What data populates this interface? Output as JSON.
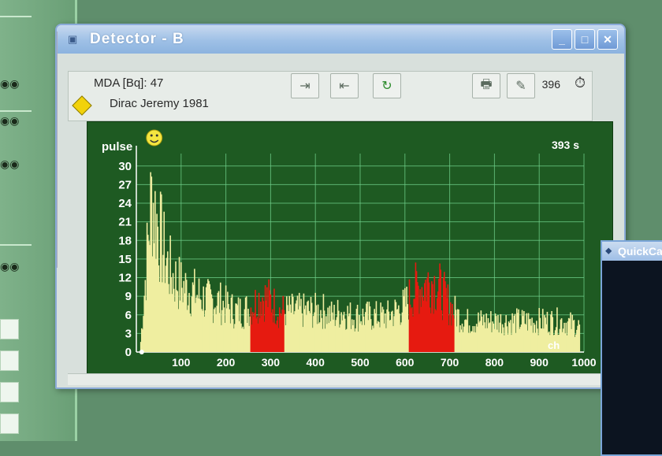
{
  "window": {
    "title": "Detector  -   B",
    "controls": {
      "minimize": "_",
      "maximize": "□",
      "close": "✕"
    }
  },
  "info": {
    "mda": "MDA [Bq]:  47",
    "person": "Dirac Jeremy  1981",
    "counter": "396"
  },
  "toolbar": {
    "buttons": [
      {
        "name": "forward-icon",
        "glyph": "⇥"
      },
      {
        "name": "back-icon",
        "glyph": "⇤"
      },
      {
        "name": "refresh-icon",
        "glyph": "↻"
      },
      {
        "name": "printer-icon",
        "glyph": "🖶"
      },
      {
        "name": "tools-icon",
        "glyph": "✎"
      }
    ]
  },
  "chart_data": {
    "type": "area",
    "ylabel": "pulse",
    "xunit": "ch",
    "time_label": "393 s",
    "xlim": [
      0,
      1000
    ],
    "ylim": [
      0,
      32
    ],
    "xticks": [
      100,
      200,
      300,
      400,
      500,
      600,
      700,
      800,
      900,
      1000
    ],
    "yticks": [
      0,
      3,
      6,
      9,
      12,
      15,
      18,
      21,
      24,
      27,
      30
    ],
    "grid": true,
    "colors": {
      "background": "#1e5a22",
      "grid": "#6fd08a",
      "series": "#efeea0",
      "region": "#e61a10"
    },
    "regions": [
      [
        255,
        330
      ],
      [
        610,
        710
      ]
    ],
    "envelope": [
      [
        10,
        2
      ],
      [
        15,
        8
      ],
      [
        20,
        14
      ],
      [
        25,
        20
      ],
      [
        30,
        26
      ],
      [
        35,
        31
      ],
      [
        40,
        28
      ],
      [
        50,
        24
      ],
      [
        60,
        20
      ],
      [
        70,
        17
      ],
      [
        80,
        15
      ],
      [
        90,
        14
      ],
      [
        100,
        13
      ],
      [
        120,
        12
      ],
      [
        140,
        11
      ],
      [
        160,
        10
      ],
      [
        180,
        10
      ],
      [
        200,
        9
      ],
      [
        220,
        8
      ],
      [
        240,
        8
      ],
      [
        260,
        9
      ],
      [
        280,
        11
      ],
      [
        300,
        10
      ],
      [
        320,
        8
      ],
      [
        340,
        8
      ],
      [
        360,
        8
      ],
      [
        380,
        8
      ],
      [
        400,
        8
      ],
      [
        420,
        8
      ],
      [
        440,
        7
      ],
      [
        460,
        8
      ],
      [
        480,
        7
      ],
      [
        500,
        7
      ],
      [
        520,
        7
      ],
      [
        540,
        7
      ],
      [
        560,
        7
      ],
      [
        580,
        8
      ],
      [
        600,
        9
      ],
      [
        620,
        12
      ],
      [
        640,
        13
      ],
      [
        660,
        14
      ],
      [
        680,
        12
      ],
      [
        700,
        9
      ],
      [
        720,
        7
      ],
      [
        740,
        6
      ],
      [
        760,
        6
      ],
      [
        800,
        6
      ],
      [
        850,
        6
      ],
      [
        900,
        6
      ],
      [
        950,
        6
      ],
      [
        990,
        5
      ]
    ]
  },
  "quick_panel": {
    "title": "QuickCa"
  }
}
